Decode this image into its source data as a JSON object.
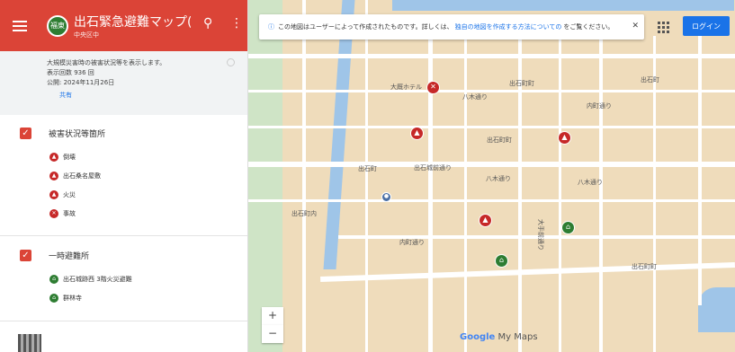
{
  "header": {
    "title": "出石緊急避難マップ(…",
    "subtitle": "中央区中",
    "logo_text": "福東",
    "search_icon": "search-icon",
    "menu_icon": "more-vert-icon"
  },
  "description": {
    "line1": "大規模災害時の被害状況等を表示します。",
    "line2": "表示回数 936 回",
    "line3": "公開: 2024年11月26日",
    "share": "共有"
  },
  "layers": [
    {
      "title": "被害状況等箇所",
      "items": [
        {
          "label": "倒壊",
          "color": "#c62828"
        },
        {
          "label": "出石桑名屋敷",
          "color": "#c62828"
        },
        {
          "label": "火災",
          "color": "#c62828"
        },
        {
          "label": "事故",
          "color": "#c62828"
        }
      ]
    },
    {
      "title": "一時避難所",
      "items": [
        {
          "label": "出石城跡西 3階火災避難",
          "color": "#2e7d32"
        },
        {
          "label": "群林寺",
          "color": "#2e7d32"
        }
      ]
    }
  ],
  "map": {
    "notice": {
      "before": "この地図はユーザーによって作成されたものです。詳しくは、",
      "link": "独自の地図を作成する方法についての",
      "after": "をご覧ください。"
    },
    "login": "ログイン",
    "zoom_in": "+",
    "zoom_out": "−",
    "brand": "Google",
    "brand_suffix": "My Maps",
    "labels": {
      "l1": "大厩ホテル",
      "l2": "出石町町",
      "l3": "出石町",
      "l4": "八木通り",
      "l5": "内町通り",
      "l6": "大手前通り",
      "l7": "出石町町",
      "l8": "出石町",
      "l9": "八木通り",
      "l10": "出石城前通り",
      "l11": "内町通り",
      "l12": "出石町内",
      "l13": "出石町町"
    }
  },
  "colors": {
    "header": "#db4437",
    "accent": "#1a73e8",
    "danger": "#c62828",
    "safe": "#2e7d32",
    "map_bg": "#efdcbb",
    "river": "#9fc5e8"
  }
}
